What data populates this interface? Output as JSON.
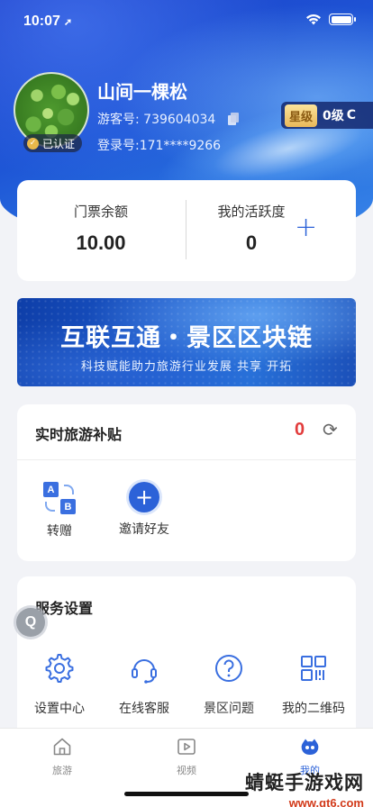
{
  "status_bar": {
    "time": "10:07",
    "location_arrow": "➚"
  },
  "profile": {
    "name": "山间一棵松",
    "verified_label": "已认证",
    "verified_icon_glyph": "✓",
    "visitor_id_label": "游客号: 739604034",
    "login_label": "登录号:171****9266",
    "star_tag": "星级",
    "level": "0级",
    "refresh_glyph": "C"
  },
  "balance": {
    "ticket_label": "门票余额",
    "ticket_value": "10.00",
    "activity_label": "我的活跃度",
    "activity_value": "0",
    "add_glyph": "+"
  },
  "banner": {
    "title": "互联互通・景区区块链",
    "subtitle": "科技赋能助力旅游行业发展  共享  开拓"
  },
  "subsidy": {
    "title": "实时旅游补贴",
    "count": "0",
    "refresh_glyph": "⟳",
    "actions": [
      {
        "label": "转赠",
        "icon": "ab-transfer-icon"
      },
      {
        "label": "邀请好友",
        "icon": "plus-circle-icon",
        "glyph": "+"
      }
    ]
  },
  "services": {
    "title": "服务设置",
    "items": [
      {
        "label": "设置中心",
        "icon": "gear-icon"
      },
      {
        "label": "在线客服",
        "icon": "headset-icon"
      },
      {
        "label": "景区问题",
        "icon": "question-icon"
      },
      {
        "label": "我的二维码",
        "icon": "qr-code-icon"
      }
    ]
  },
  "float_button": {
    "glyph": "Q"
  },
  "tab_bar": {
    "items": [
      {
        "label": "旅游",
        "icon": "home-icon",
        "active": false
      },
      {
        "label": "视频",
        "icon": "video-icon",
        "active": false
      },
      {
        "label": "我的",
        "icon": "profile-face-icon",
        "active": true
      }
    ]
  },
  "watermark": {
    "line1": "蜻蜓手游戏网",
    "line2": "www.qt6.com"
  },
  "colors": {
    "accent": "#2c62d8",
    "count_red": "#e23c3c",
    "background": "#f2f3f7",
    "star_tag_gold": "#e9b85a"
  }
}
